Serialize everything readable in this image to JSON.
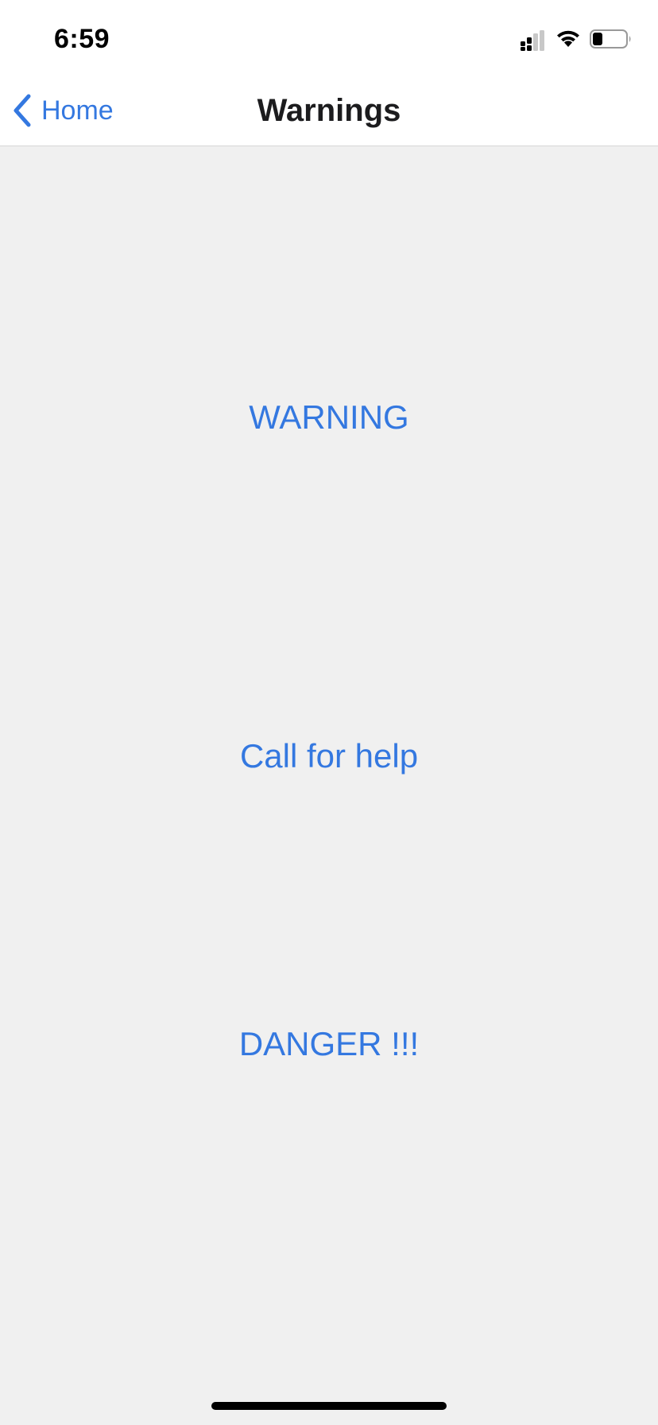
{
  "status_bar": {
    "time": "6:59",
    "icons": [
      "cellular-signal-icon",
      "wifi-icon",
      "battery-icon"
    ],
    "battery_level": 0.3
  },
  "nav": {
    "back_label": "Home",
    "back_icon": "chevron-left-icon",
    "title": "Warnings"
  },
  "buttons": {
    "warning": "WARNING",
    "call_for_help": "Call for help",
    "danger": "DANGER !!!"
  },
  "colors": {
    "accent": "#3478e0",
    "background": "#f0f0f0",
    "bar_background": "#ffffff",
    "title_text": "#1c1c1e"
  }
}
